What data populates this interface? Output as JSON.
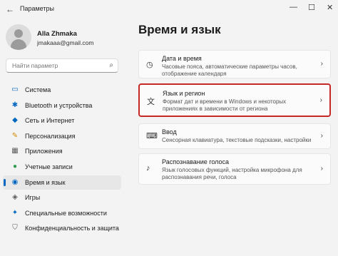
{
  "window": {
    "title": "Параметры",
    "back_glyph": "←",
    "minimize_glyph": "—",
    "maximize_glyph": "☐",
    "close_glyph": "✕"
  },
  "profile": {
    "name": "Alla Zhmaka",
    "email": "jmakaaa@gmail.com"
  },
  "search": {
    "placeholder": "Найти параметр"
  },
  "sidebar": {
    "items": [
      {
        "label": "Система",
        "icon": "monitor-icon",
        "glyph": "▭",
        "color": "#0067c0"
      },
      {
        "label": "Bluetooth и устройства",
        "icon": "bluetooth-icon",
        "glyph": "✱",
        "color": "#0067c0"
      },
      {
        "label": "Сеть и Интернет",
        "icon": "wifi-icon",
        "glyph": "◆",
        "color": "#0067c0"
      },
      {
        "label": "Персонализация",
        "icon": "brush-icon",
        "glyph": "✎",
        "color": "#d08a00"
      },
      {
        "label": "Приложения",
        "icon": "apps-icon",
        "glyph": "▦",
        "color": "#5a5a5a"
      },
      {
        "label": "Учетные записи",
        "icon": "person-icon",
        "glyph": "●",
        "color": "#2e9b4f"
      },
      {
        "label": "Время и язык",
        "icon": "globe-clock-icon",
        "glyph": "◉",
        "color": "#0067c0"
      },
      {
        "label": "Игры",
        "icon": "gamepad-icon",
        "glyph": "◈",
        "color": "#5a5a5a"
      },
      {
        "label": "Специальные возможности",
        "icon": "accessibility-icon",
        "glyph": "✦",
        "color": "#0067c0"
      },
      {
        "label": "Конфиденциальность и защита",
        "icon": "shield-icon",
        "glyph": "⛉",
        "color": "#5a5a5a"
      }
    ],
    "active_index": 6
  },
  "main": {
    "title": "Время и язык",
    "cards": [
      {
        "title": "Дата и время",
        "desc": "Часовые пояса, автоматические параметры часов, отображение календаря",
        "icon": "calendar-clock-icon",
        "glyph": "◷"
      },
      {
        "title": "Язык и регион",
        "desc": "Формат дат и времени в Windows и некоторых приложениях в зависимости от региона",
        "icon": "language-icon",
        "glyph": "文"
      },
      {
        "title": "Ввод",
        "desc": "Сенсорная клавиатура, текстовые подсказки, настройки",
        "icon": "keyboard-icon",
        "glyph": "⌨"
      },
      {
        "title": "Распознавание голоса",
        "desc": "Язык голосовых функций, настройка микрофона для распознавания речи, голоса",
        "icon": "voice-icon",
        "glyph": "♪"
      }
    ],
    "chevron": "›"
  },
  "colors": {
    "accent": "#0067c0",
    "highlight_border": "#c62828",
    "background": "#f3f3f3"
  }
}
